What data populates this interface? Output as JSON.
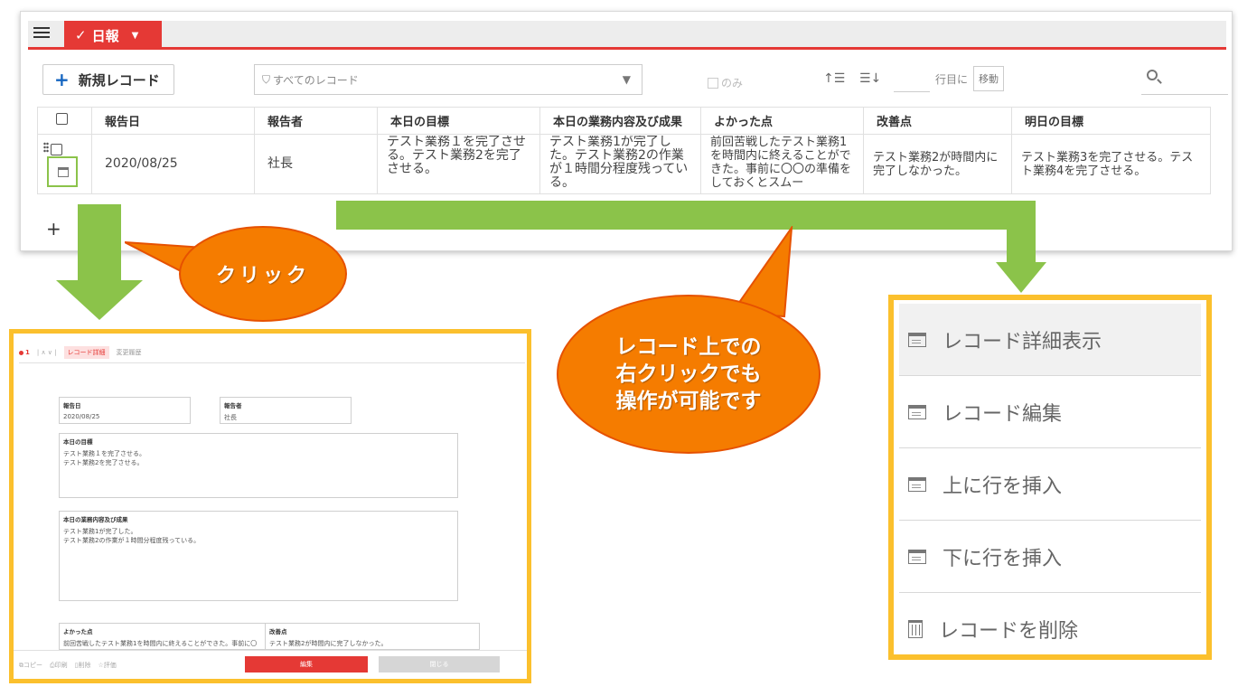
{
  "tab": {
    "label": "日報"
  },
  "toolbar": {
    "new_record": "新規レコード",
    "filter_label": "すべてのレコード",
    "only_label": "のみ",
    "goto_row_label": "行目に",
    "move_button": "移動"
  },
  "table": {
    "columns": [
      "報告日",
      "報告者",
      "本日の目標",
      "本日の業務内容及び成果",
      "よかった点",
      "改善点",
      "明日の目標"
    ],
    "row": {
      "date": "2020/08/25",
      "reporter": "社長",
      "goal": "テスト業務１を完了させる。テスト業務2を完了させる。",
      "work": "テスト業務1が完了した。テスト業務2の作業が１時間分程度残っている。",
      "good": "前回苦戦したテスト業務1を時間内に終えることができた。事前に〇〇の準備をしておくとスムー",
      "improve": "テスト業務2が時間内に完了しなかった。",
      "tomorrow": "テスト業務3を完了させる。テスト業務4を完了させる。"
    }
  },
  "callouts": {
    "click": "クリック",
    "right_click_lines": [
      "レコード上での",
      "右クリックでも",
      "操作が可能です"
    ]
  },
  "dialog": {
    "record_no": "1",
    "tab_detail": "レコード詳細",
    "tab_history": "変更履歴",
    "fields": {
      "date_label": "報告日",
      "date_value": "2020/08/25",
      "reporter_label": "報告者",
      "reporter_value": "社長",
      "goal_label": "本日の目標",
      "goal_line1": "テスト業務１を完了させる。",
      "goal_line2": "テスト業務2を完了させる。",
      "work_label": "本日の業務内容及び成果",
      "work_line1": "テスト業務1が完了した。",
      "work_line2": "テスト業務2の作業が１時間分程度残っている。",
      "good_label": "よかった点",
      "good_value": "前回苦戦したテスト業務1を時間内に終えることができた。事前に〇",
      "improve_label": "改善点",
      "improve_value": "テスト業務2が時間内に完了しなかった。"
    },
    "footer": {
      "copy": "コピー",
      "print": "印刷",
      "delete": "削除",
      "rate": "評価",
      "edit": "編集",
      "close": "閉じる"
    }
  },
  "context_menu": {
    "items": [
      "レコード詳細表示",
      "レコード編集",
      "上に行を挿入",
      "下に行を挿入",
      "レコードを削除"
    ]
  }
}
